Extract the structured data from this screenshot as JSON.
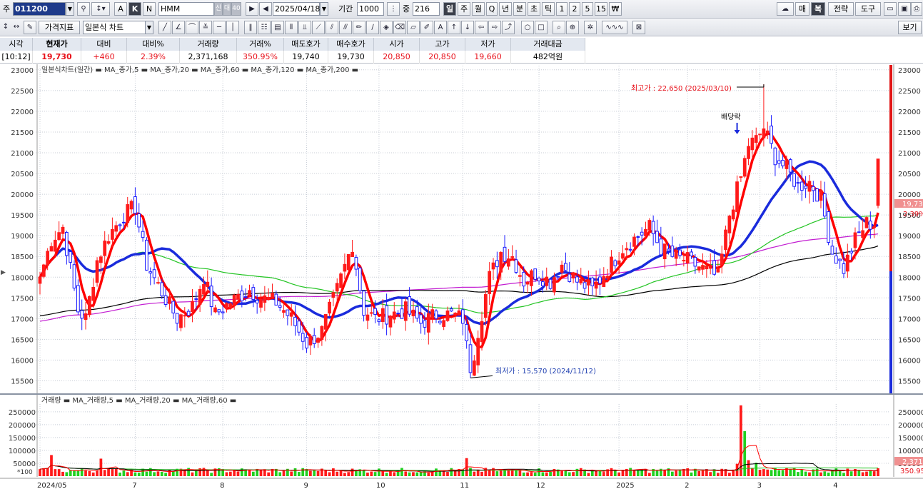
{
  "toolbar1": {
    "code_label": "주",
    "code": "011200",
    "letters": [
      "A",
      "K",
      "N"
    ],
    "name": "HMM",
    "credit": "신",
    "credit2": "대",
    "margin": "40",
    "date": "2025/04/18",
    "period_label": "기간",
    "period": "1000",
    "count_label": "중",
    "count": "216",
    "periods": [
      "일",
      "주",
      "월",
      "Q",
      "년",
      "분",
      "초",
      "틱",
      "1",
      "2",
      "5",
      "15",
      "₩"
    ],
    "right_buttons": [
      "매",
      "복",
      "전략",
      "도구"
    ]
  },
  "toolbar2": {
    "price_indicator": "가격지표",
    "chart_type": "일본식 차트",
    "view_label": "보기"
  },
  "quote": {
    "headers": [
      "시각",
      "현재가",
      "대비",
      "대비%",
      "거래량",
      "거래%",
      "매도호가",
      "매수호가",
      "시가",
      "고가",
      "저가",
      "거래대금"
    ],
    "values": [
      "[10:12]",
      "19,730",
      "+460",
      "2.39%",
      "2,371,168",
      "350.95%",
      "19,740",
      "19,730",
      "20,850",
      "20,850",
      "19,660",
      "482억원"
    ]
  },
  "price_legend": "일본식차트(일간) ▬ MA_종가,5 ▬ MA_종가,20 ▬ MA_종가,60 ▬ MA_종가,120 ▬ MA_종가,200 ▬",
  "volume_legend": "거래량 ▬ MA_거래량,5 ▬ MA_거래량,20 ▬ MA_거래량,60 ▬",
  "annotations": {
    "high": "최고가 : 22,650 (2025/03/10)",
    "low": "최저가 : 15,570 (2024/11/12)",
    "dividend": "배당락"
  },
  "right_labels": {
    "price": "19,73",
    "pct": "2.39%",
    "vol": "2,371",
    "volpct": "350.95"
  },
  "colors": {
    "up": "#ff1a1a",
    "down": "#1a1aff",
    "ma5": "#ff0000",
    "ma20": "#1a2bdc",
    "ma60": "#22c422",
    "ma120": "#000000",
    "ma200": "#c21bd1"
  },
  "chart_data": [
    {
      "type": "candlestick",
      "title": "일본식차트(일간)",
      "ylim": [
        15250,
        23100
      ],
      "y_ticks": [
        15500,
        16000,
        16500,
        17000,
        17500,
        18000,
        18500,
        19000,
        19500,
        20000,
        20500,
        21000,
        21500,
        22000,
        22500,
        23000
      ],
      "x_labels": [
        {
          "label": "2024/05",
          "index": 0
        },
        {
          "label": "7",
          "index": 25
        },
        {
          "label": "8",
          "index": 48
        },
        {
          "label": "9",
          "index": 70
        },
        {
          "label": "10",
          "index": 89
        },
        {
          "label": "11",
          "index": 111
        },
        {
          "label": "12",
          "index": 131
        },
        {
          "label": "2025",
          "index": 152
        },
        {
          "label": "2",
          "index": 170
        },
        {
          "label": "3",
          "index": 189
        },
        {
          "label": "4",
          "index": 209
        }
      ],
      "close_anchors": [
        [
          0,
          18000
        ],
        [
          3,
          18900
        ],
        [
          6,
          19200
        ],
        [
          10,
          17200
        ],
        [
          12,
          17000
        ],
        [
          15,
          18400
        ],
        [
          18,
          19000
        ],
        [
          22,
          19500
        ],
        [
          25,
          19700
        ],
        [
          28,
          18300
        ],
        [
          31,
          17800
        ],
        [
          36,
          17000
        ],
        [
          40,
          17300
        ],
        [
          43,
          18000
        ],
        [
          46,
          17100
        ],
        [
          50,
          17400
        ],
        [
          55,
          17700
        ],
        [
          58,
          17500
        ],
        [
          62,
          17400
        ],
        [
          66,
          17000
        ],
        [
          70,
          16400
        ],
        [
          74,
          16700
        ],
        [
          78,
          17700
        ],
        [
          82,
          18800
        ],
        [
          85,
          17200
        ],
        [
          88,
          17000
        ],
        [
          92,
          17100
        ],
        [
          96,
          17200
        ],
        [
          100,
          16900
        ],
        [
          104,
          17100
        ],
        [
          108,
          17100
        ],
        [
          111,
          17000
        ],
        [
          113,
          15650
        ],
        [
          115,
          16700
        ],
        [
          118,
          18000
        ],
        [
          121,
          18600
        ],
        [
          124,
          18500
        ],
        [
          127,
          17900
        ],
        [
          130,
          18100
        ],
        [
          134,
          17900
        ],
        [
          137,
          18300
        ],
        [
          141,
          17900
        ],
        [
          145,
          17700
        ],
        [
          149,
          18200
        ],
        [
          153,
          18700
        ],
        [
          157,
          19000
        ],
        [
          160,
          19200
        ],
        [
          163,
          18700
        ],
        [
          166,
          18500
        ],
        [
          170,
          18400
        ],
        [
          174,
          18200
        ],
        [
          178,
          18000
        ],
        [
          181,
          19500
        ],
        [
          184,
          20400
        ],
        [
          186,
          21200
        ],
        [
          188,
          21300
        ],
        [
          190,
          21600
        ],
        [
          193,
          20900
        ],
        [
          196,
          20600
        ],
        [
          199,
          20200
        ],
        [
          202,
          20300
        ],
        [
          205,
          19900
        ],
        [
          208,
          18600
        ],
        [
          211,
          18200
        ],
        [
          214,
          18900
        ],
        [
          217,
          19300
        ],
        [
          220,
          19270
        ]
      ],
      "last_candle": {
        "open": 20850,
        "high": 20850,
        "low": 19660,
        "close": 19730
      },
      "high_point": {
        "index": 190,
        "value": 22650
      },
      "low_point": {
        "index": 113,
        "value": 15570
      },
      "dividend_index": 183,
      "ma_series": [
        {
          "name": "MA_종가,5"
        },
        {
          "name": "MA_종가,20"
        },
        {
          "name": "MA_종가,60"
        },
        {
          "name": "MA_종가,120"
        },
        {
          "name": "MA_종가,200"
        }
      ]
    },
    {
      "type": "bar",
      "title": "거래량",
      "ylim": [
        0,
        280000
      ],
      "y_ticks": [
        50000,
        100000,
        150000,
        200000,
        250000
      ],
      "y_unit": "*100",
      "spikes": [
        {
          "index": 184,
          "value": 275000,
          "color": "up"
        },
        {
          "index": 185,
          "value": 175000,
          "color": "down"
        },
        {
          "index": 183,
          "value": 48000,
          "color": "up"
        },
        {
          "index": 186,
          "value": 62000,
          "color": "up"
        },
        {
          "index": 188,
          "value": 52000,
          "color": "down"
        },
        {
          "index": 3,
          "value": 82000,
          "color": "up"
        },
        {
          "index": 16,
          "value": 68000,
          "color": "up"
        },
        {
          "index": 112,
          "value": 70000,
          "color": "up"
        }
      ],
      "base_volume": 25000,
      "ma_series": [
        {
          "name": "MA_거래량,5"
        },
        {
          "name": "MA_거래량,20"
        },
        {
          "name": "MA_거래량,60"
        }
      ]
    }
  ]
}
